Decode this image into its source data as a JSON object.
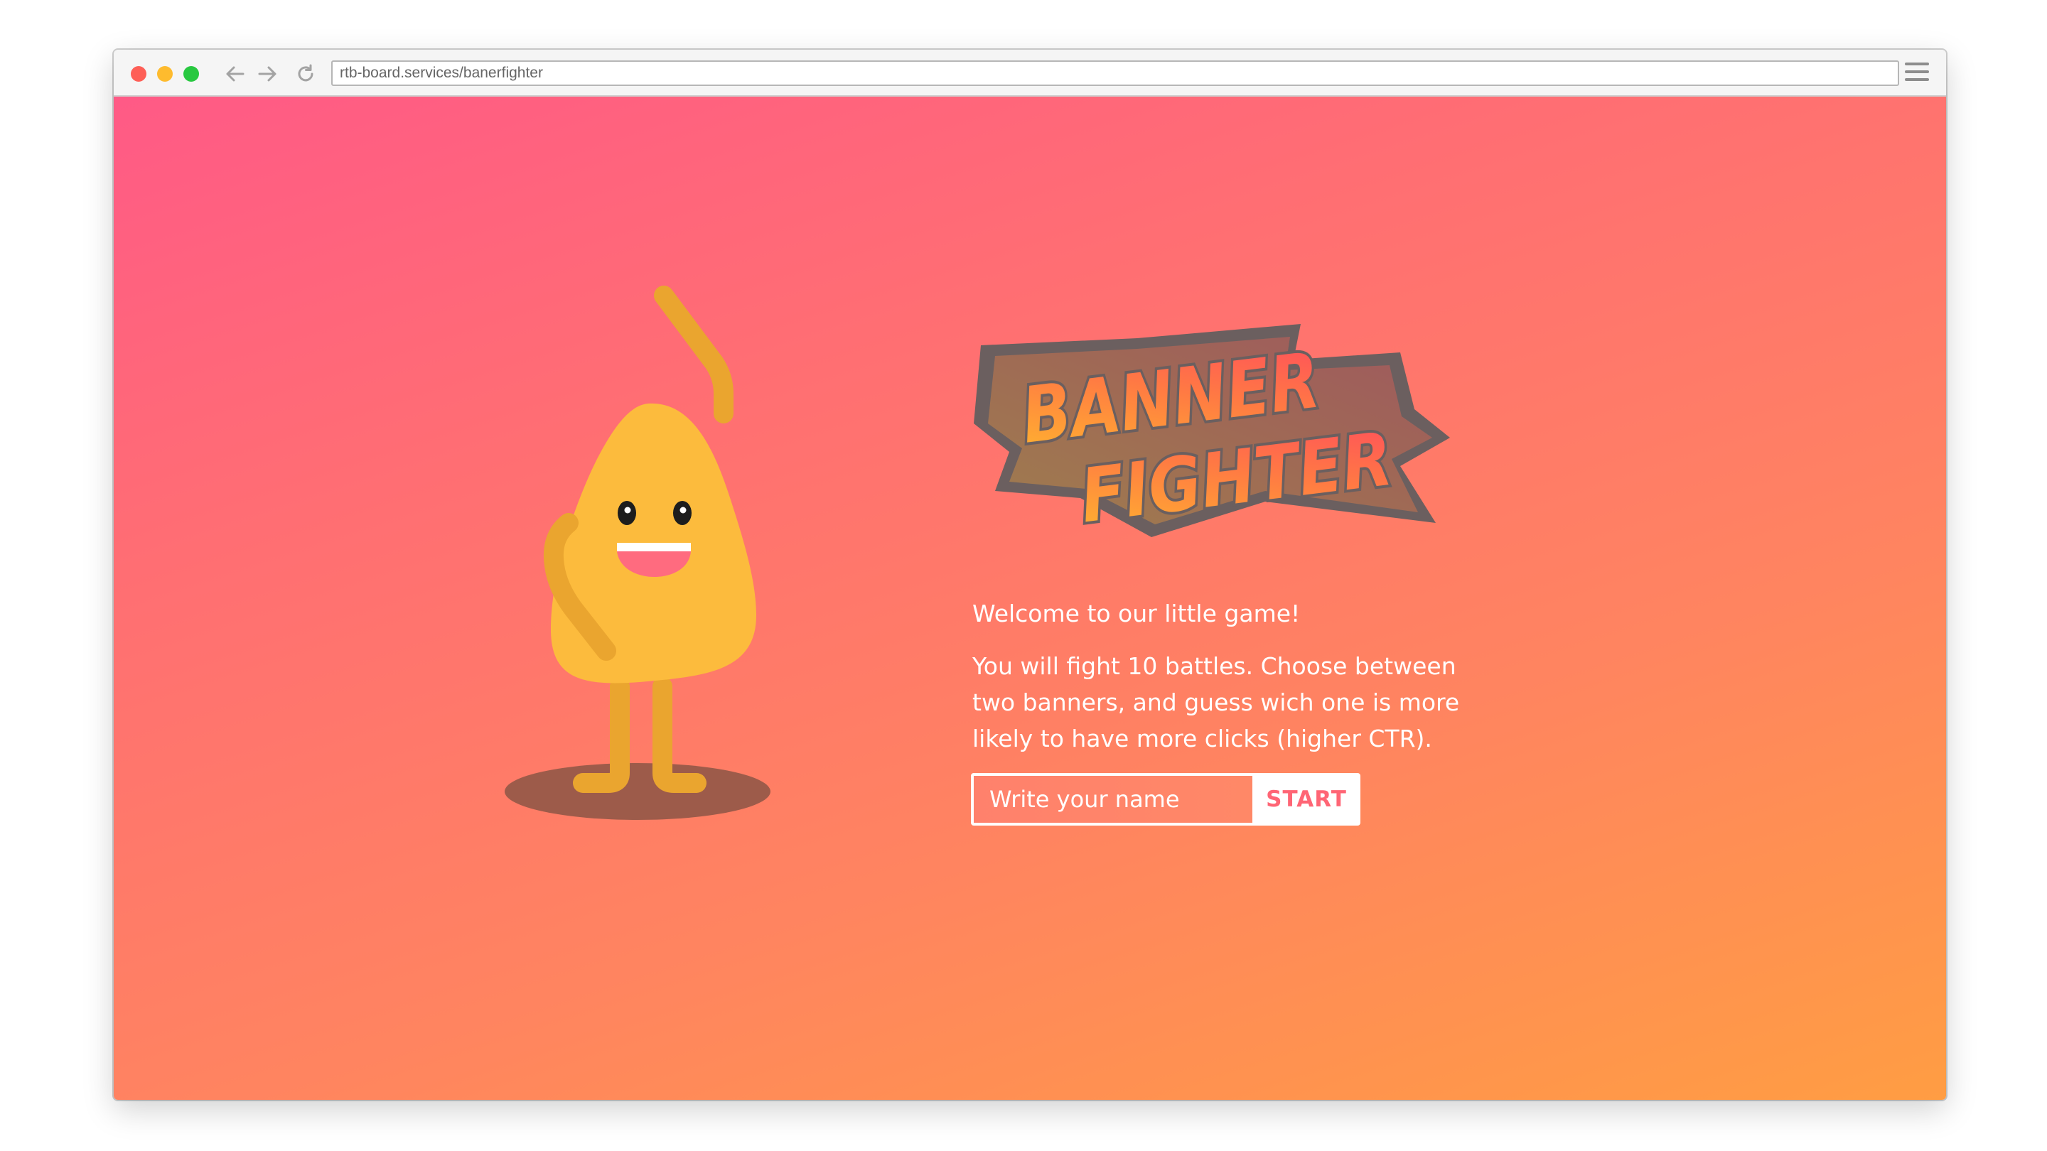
{
  "browser": {
    "url": "rtb-board.services/banerfighter",
    "controls": {
      "close_color": "#fe5f57",
      "minimize_color": "#febb2e",
      "maximize_color": "#28c840",
      "back_icon": "arrow-left-icon",
      "forward_icon": "arrow-right-icon",
      "reload_icon": "reload-icon",
      "menu_icon": "hamburger-menu-icon"
    }
  },
  "page": {
    "background_colors": [
      "#ff5a86",
      "#ff9d43"
    ],
    "logo": {
      "line1": "BANNER",
      "line2": "FIGHTER",
      "gradient": [
        "#ffb52e",
        "#ff4f5c"
      ],
      "outline_color": "#6b5f5f"
    },
    "mascot": {
      "body_color": "#fcbb3d",
      "limb_color": "#eaa52f",
      "shadow_color": "#9d5b4a",
      "mouth_color": "#ff6b7f"
    },
    "welcome": "Welcome to our little game!",
    "intro": "You will fight 10 battles. Choose between two banners, and guess wich one is more likely to have more clicks (higher CTR).",
    "form": {
      "name_placeholder": "Write your name",
      "start_label": "START",
      "start_color": "#ff6575"
    }
  }
}
